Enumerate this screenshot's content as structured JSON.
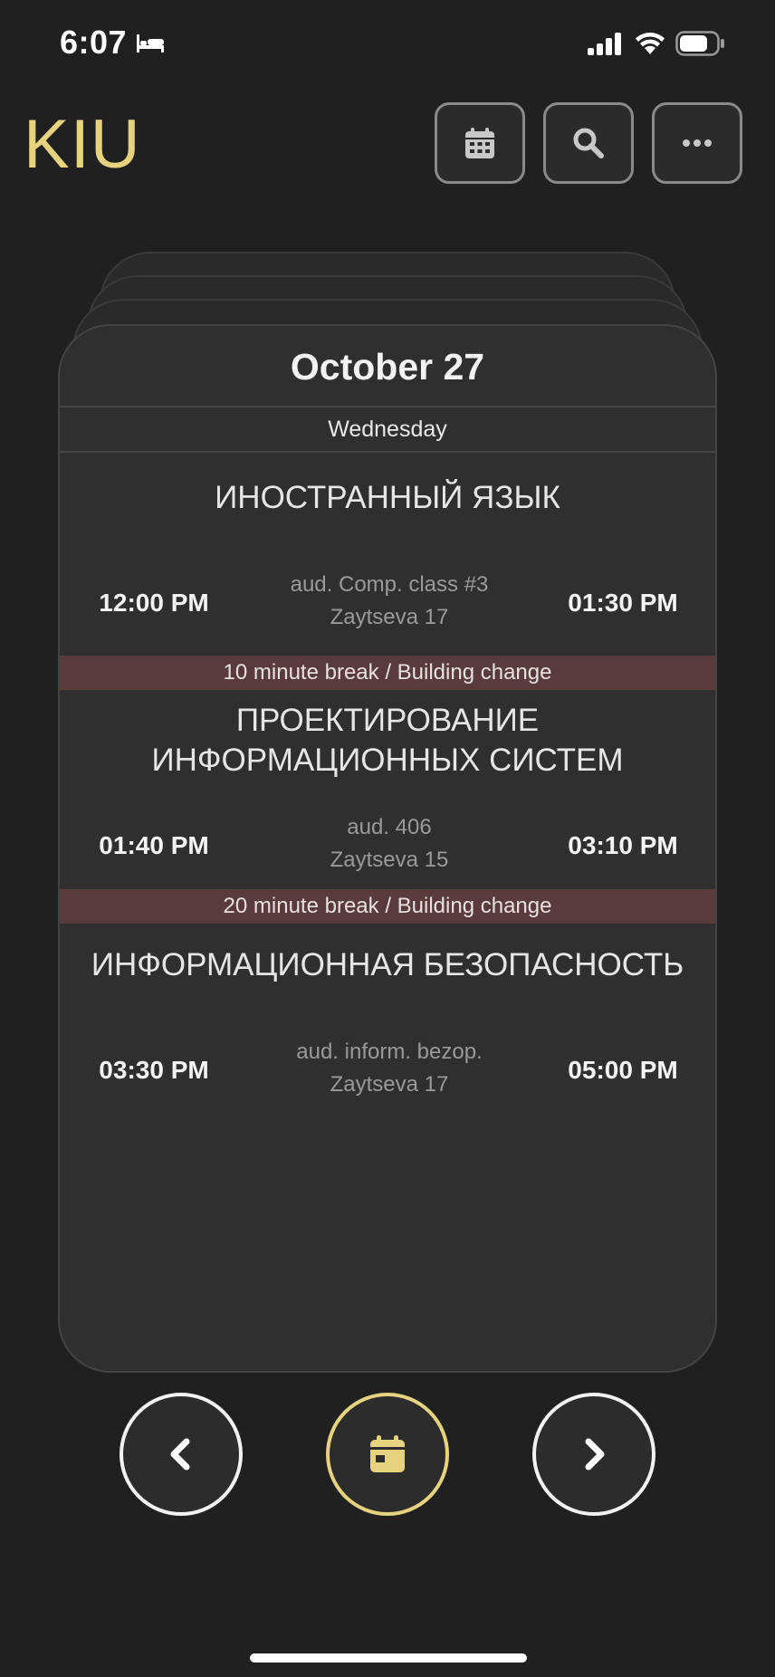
{
  "status_bar": {
    "time": "6:07",
    "bed_icon": "bed-icon",
    "signal_icon": "signal-icon",
    "wifi_icon": "wifi-icon",
    "battery_icon": "battery-icon"
  },
  "header": {
    "title": "KIU",
    "title_color": "#e6d27f",
    "buttons": [
      {
        "name": "calendar",
        "icon": "calendar-grid-icon"
      },
      {
        "name": "search",
        "icon": "search-icon"
      },
      {
        "name": "more",
        "icon": "more-horizontal-icon"
      }
    ]
  },
  "day": {
    "date": "October 27",
    "weekday": "Wednesday",
    "lessons": [
      {
        "subject": "ИНОСТРАННЫЙ ЯЗЫК",
        "start": "12:00 PM",
        "end": "01:30 PM",
        "room": "aud. Comp. class #3",
        "building": "Zaytseva 17"
      },
      {
        "subject_line1": "ПРОЕКТИРОВАНИЕ",
        "subject_line2": "ИНФОРМАЦИОННЫХ СИСТЕМ",
        "start": "01:40 PM",
        "end": "03:10 PM",
        "room": "aud. 406",
        "building": "Zaytseva 15"
      },
      {
        "subject": "ИНФОРМАЦИОННАЯ БЕЗОПАСНОСТЬ",
        "start": "03:30 PM",
        "end": "05:00 PM",
        "room": "aud. inform. bezop.",
        "building": "Zaytseva 17"
      }
    ],
    "breaks": [
      "10 minute break / Building change",
      "20 minute break / Building change"
    ],
    "break_color": "#5a3b3c"
  },
  "bottom_nav": {
    "prev_icon": "chevron-left-icon",
    "today_icon": "calendar-today-icon",
    "next_icon": "chevron-right-icon",
    "accent_color": "#e6d27f"
  }
}
